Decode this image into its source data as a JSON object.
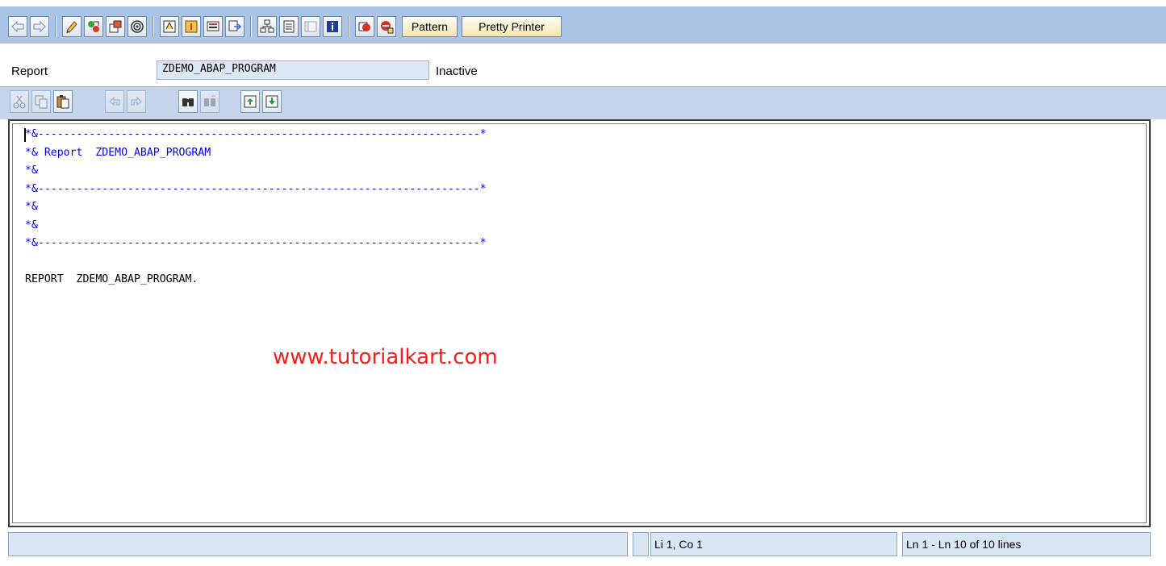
{
  "toolbar": {
    "icons": [
      "back-icon",
      "forward-icon",
      "check-syntax-icon",
      "display-object-list-icon",
      "where-used-icon",
      "display-navigation-window-icon",
      "activate-icon",
      "test-icon",
      "enhance-icon",
      "display-object-icon",
      "hierarchy-icon",
      "list-icon",
      "block-icon",
      "help-info-icon",
      "stop-icon",
      "breakpoint-icon"
    ],
    "pattern_label": "Pattern",
    "pretty_printer_label": "Pretty Printer"
  },
  "header": {
    "object_type_label": "Report",
    "program_name": "ZDEMO_ABAP_PROGRAM",
    "status": "Inactive"
  },
  "editor_toolbar": {
    "icons": [
      "cut-icon",
      "copy-icon",
      "paste-icon",
      "undo-icon",
      "redo-icon",
      "find-icon",
      "find-next-icon",
      "upload-icon",
      "download-icon"
    ]
  },
  "editor": {
    "lines": [
      {
        "text": "*&---------------------------------------------------------------------*",
        "kind": "comment"
      },
      {
        "text": "*& Report  ZDEMO_ABAP_PROGRAM",
        "kind": "comment"
      },
      {
        "text": "*&",
        "kind": "comment"
      },
      {
        "text": "*&---------------------------------------------------------------------*",
        "kind": "comment"
      },
      {
        "text": "*&",
        "kind": "comment"
      },
      {
        "text": "*&",
        "kind": "comment"
      },
      {
        "text": "*&---------------------------------------------------------------------*",
        "kind": "comment"
      },
      {
        "text": "",
        "kind": "code"
      },
      {
        "text": "REPORT  ZDEMO_ABAP_PROGRAM.",
        "kind": "code"
      },
      {
        "text": "",
        "kind": "code"
      }
    ],
    "watermark": "www.tutorialkart.com"
  },
  "status_bar": {
    "message": "",
    "cursor_position": "Li 1, Co 1",
    "line_range": "Ln 1 - Ln 10 of 10 lines"
  }
}
